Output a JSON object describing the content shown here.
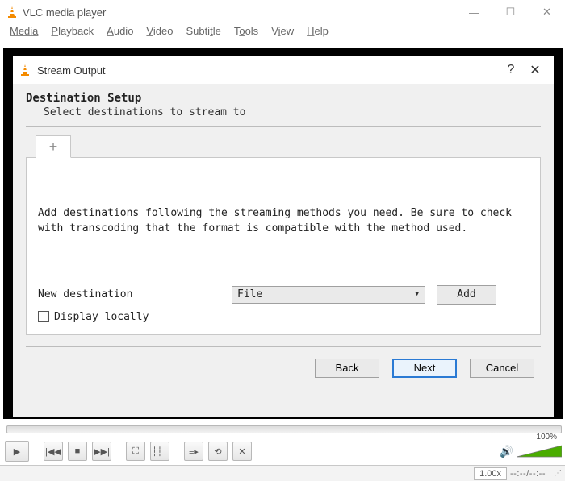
{
  "window": {
    "title": "VLC media player",
    "menu": [
      "Media",
      "Playback",
      "Audio",
      "Video",
      "Subtitle",
      "Tools",
      "View",
      "Help"
    ]
  },
  "dialog": {
    "title": "Stream Output",
    "section_title": "Destination Setup",
    "section_sub": "Select destinations to stream to",
    "help_text": "Add destinations following the streaming methods you need. Be sure to check with transcoding that the format is compatible with the method used.",
    "new_dest_label": "New destination",
    "dest_select": "File",
    "add_label": "Add",
    "display_locally_label": "Display locally",
    "display_locally_checked": false,
    "buttons": {
      "back": "Back",
      "next": "Next",
      "cancel": "Cancel"
    },
    "tab_plus": "+"
  },
  "player": {
    "volume_percent": "100%",
    "speed": "1.00x",
    "time": "--:--/--:--"
  },
  "icons": {
    "minimize": "—",
    "maximize": "☐",
    "close": "✕",
    "help": "?",
    "dlg_close": "✕",
    "play": "▶",
    "prev": "|◀◀",
    "stop": "■",
    "next": "▶▶|",
    "fullscreen": "⛶",
    "ext": "┆┆┆",
    "playlist": "≡▸",
    "loop": "⟲",
    "shuffle": "✕",
    "speaker": "🔊"
  }
}
